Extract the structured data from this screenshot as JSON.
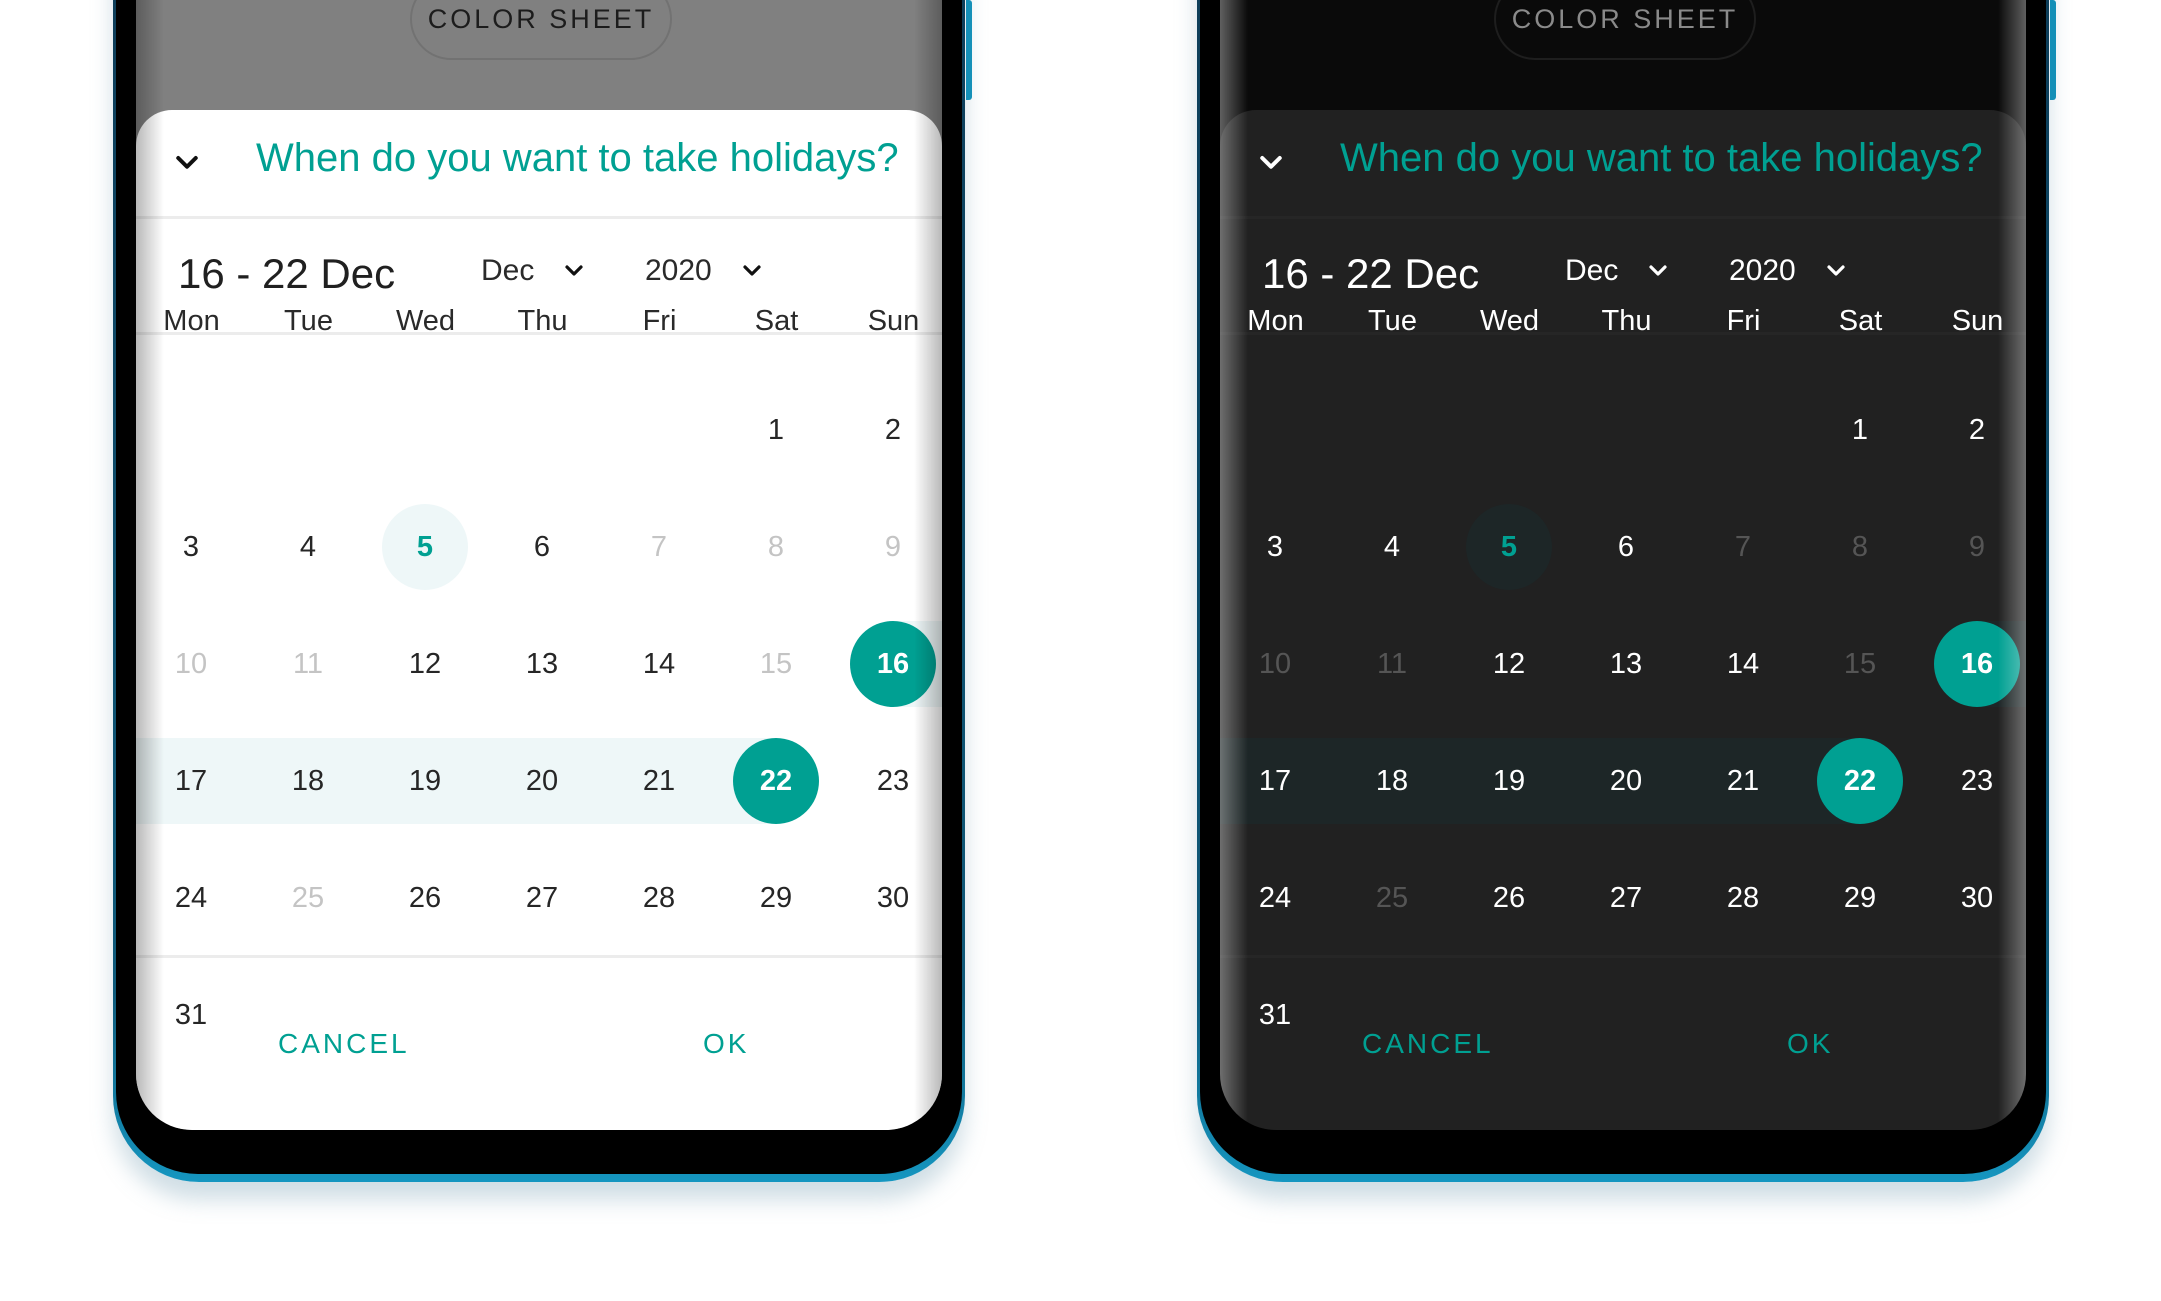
{
  "theme_colors": {
    "accent": "#00a092",
    "light_range_bg": "#eef7f8",
    "dark_sheet_bg": "#212121",
    "dark_range_bg": "#1d2627"
  },
  "phones": [
    {
      "theme": "light",
      "background_button": "COLOR SHEET",
      "title": "When do you want to take holidays?",
      "selected_range": "16 - 22 Dec",
      "month_select": "Dec",
      "year_select": "2020",
      "weekdays": [
        "Mon",
        "Tue",
        "Wed",
        "Thu",
        "Fri",
        "Sat",
        "Sun"
      ],
      "cancel": "CANCEL",
      "ok": "OK"
    },
    {
      "theme": "dark",
      "background_button": "COLOR SHEET",
      "title": "When do you want to take holidays?",
      "selected_range": "16 - 22 Dec",
      "month_select": "Dec",
      "year_select": "2020",
      "weekdays": [
        "Mon",
        "Tue",
        "Wed",
        "Thu",
        "Fri",
        "Sat",
        "Sun"
      ],
      "cancel": "CANCEL",
      "ok": "OK"
    }
  ],
  "calendar": {
    "month": "Dec",
    "year": "2020",
    "first_weekday_index": 5,
    "days_in_month": 31,
    "today": 5,
    "range_start": 16,
    "range_end": 22,
    "disabled_days": [
      7,
      8,
      9,
      10,
      11,
      15,
      25
    ]
  }
}
